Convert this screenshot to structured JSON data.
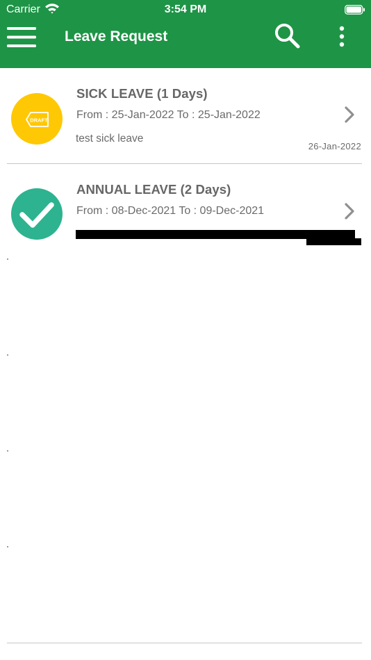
{
  "status_bar": {
    "carrier": "Carrier",
    "time": "3:54 PM",
    "icons": [
      "wifi-icon",
      "battery-icon"
    ]
  },
  "header": {
    "title": "Leave Request",
    "background_color": "#1e9446",
    "icons": [
      "menu-icon",
      "search-icon",
      "more-vertical-icon"
    ]
  },
  "leave_requests": [
    {
      "title": "SICK LEAVE (1 Days)",
      "dates": "From : 25-Jan-2022 To : 25-Jan-2022",
      "reason": "test sick leave",
      "created": "26-Jan-2022",
      "status_icon": "draft-tag-icon",
      "badge_text": "DRAFT",
      "status_color": "#ffc804"
    },
    {
      "title": "ANNUAL LEAVE (2 Days)",
      "dates": "From : 08-Dec-2021 To : 09-Dec-2021",
      "reason": "",
      "created": "",
      "status_icon": "checkmark-icon",
      "status_color": "#2db38f"
    }
  ]
}
